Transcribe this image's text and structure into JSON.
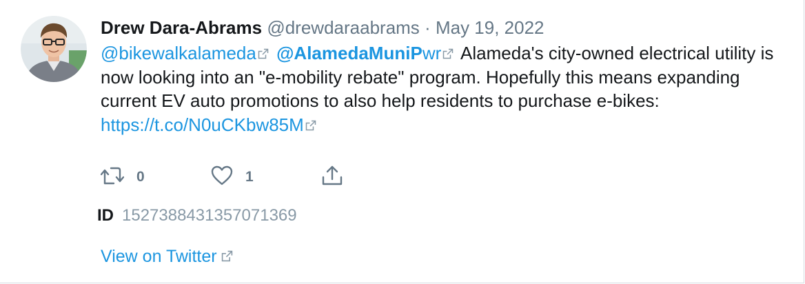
{
  "tweet": {
    "author_name": "Drew Dara-Abrams",
    "author_handle": "@drewdaraabrams",
    "separator": "·",
    "date": "May 19, 2022",
    "mention_1": "@bikewalkalameda",
    "mention_2_bold": "@AlamedaMuniP",
    "mention_2_rest": "wr",
    "text": "Alameda's city-owned electrical utility is now looking into an \"e-mobility rebate\" program. Hopefully this means expanding current EV auto promotions to also help residents to purchase e-bikes:",
    "url": "https://t.co/N0uCKbw85M",
    "retweet_count": "0",
    "like_count": "1",
    "id_label": "ID",
    "id_value": "1527388431357071369",
    "view_link": "View on Twitter"
  },
  "icons": {
    "retweet": "retweet-icon",
    "like": "heart-icon",
    "share": "share-icon",
    "external": "external-link-icon",
    "avatar": "avatar"
  },
  "colors": {
    "link": "#1b95e0",
    "secondary": "#657786",
    "text": "#14171a"
  }
}
